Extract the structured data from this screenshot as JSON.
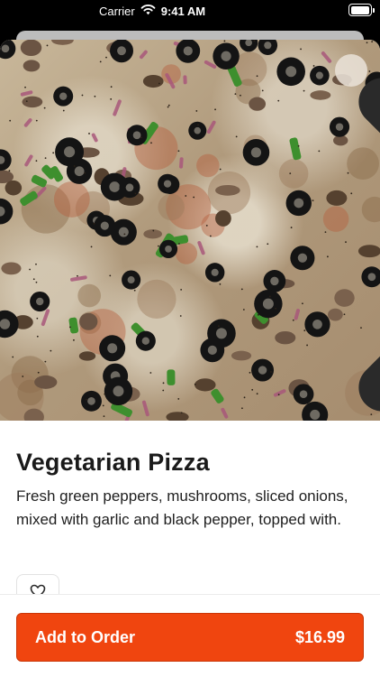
{
  "status_bar": {
    "carrier": "Carrier",
    "time": "9:41 AM",
    "battery_level": 1.0,
    "icons": [
      "wifi-icon",
      "battery-icon"
    ]
  },
  "item": {
    "image": "pizza-photo",
    "title": "Vegetarian Pizza",
    "description": "Fresh green peppers, mushrooms, sliced onions, mixed with garlic and black pepper, topped with."
  },
  "actions": {
    "close_icon": "close-icon",
    "favorite_icon": "heart-outline-icon"
  },
  "order_button": {
    "label": "Add to Order",
    "price": "$16.99"
  },
  "colors": {
    "accent": "#f0450f",
    "accent_border": "#c83607",
    "text": "#1a1a1a"
  }
}
